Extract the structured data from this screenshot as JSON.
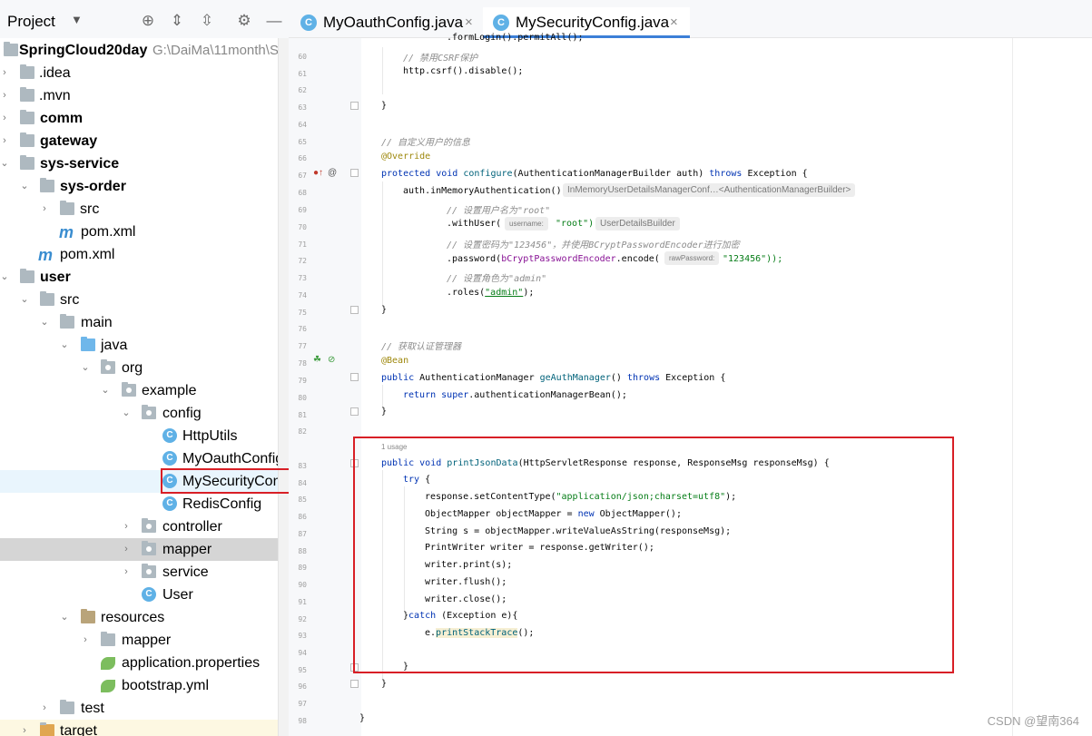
{
  "project_panel": {
    "title": "Project",
    "tree": [
      {
        "label": "SpringCloud20day",
        "path": "G:\\DaiMa\\11month\\S",
        "bold": true
      },
      {
        "label": ".idea"
      },
      {
        "label": ".mvn"
      },
      {
        "label": "comm",
        "bold": true
      },
      {
        "label": "gateway",
        "bold": true
      },
      {
        "label": "sys-service",
        "bold": true
      },
      {
        "label": "sys-order",
        "bold": true
      },
      {
        "label": "src"
      },
      {
        "label": "pom.xml"
      },
      {
        "label": "pom.xml"
      },
      {
        "label": "user",
        "bold": true
      },
      {
        "label": "src"
      },
      {
        "label": "main"
      },
      {
        "label": "java"
      },
      {
        "label": "org"
      },
      {
        "label": "example"
      },
      {
        "label": "config"
      },
      {
        "label": "HttpUtils"
      },
      {
        "label": "MyOauthConfig"
      },
      {
        "label": "MySecurityConfi"
      },
      {
        "label": "RedisConfig"
      },
      {
        "label": "controller"
      },
      {
        "label": "mapper"
      },
      {
        "label": "service"
      },
      {
        "label": "User"
      },
      {
        "label": "resources"
      },
      {
        "label": "mapper"
      },
      {
        "label": "application.properties"
      },
      {
        "label": "bootstrap.yml"
      },
      {
        "label": "test"
      },
      {
        "label": "target"
      }
    ]
  },
  "tabs": [
    {
      "label": "MyOauthConfig.java",
      "close": "×",
      "icon": "C"
    },
    {
      "label": "MySecurityConfig.java",
      "close": "×",
      "icon": "C"
    }
  ],
  "line_numbers": [
    "60",
    "61",
    "62",
    "63",
    "64",
    "65",
    "66",
    "67",
    "68",
    "69",
    "70",
    "71",
    "72",
    "73",
    "74",
    "75",
    "76",
    "77",
    "78",
    "79",
    "80",
    "81",
    "82",
    "83",
    "84",
    "85",
    "86",
    "87",
    "88",
    "89",
    "90",
    "91",
    "92",
    "93",
    "94",
    "95",
    "96",
    "97",
    "98"
  ],
  "code": {
    "top_cut": ".formLogin().permitAll();",
    "c_csrf": "// 禁用CSRF保护",
    "csrf": "http.csrf().disable();",
    "c_user_info": "// 自定义用户的信息",
    "override": "@Override",
    "configure_sig": [
      "protected",
      "void",
      "configure",
      "(AuthenticationManagerBuilder auth)",
      "throws",
      "Exception {"
    ],
    "inmem": "auth.inMemoryAuthentication()",
    "hint_inmem": "InMemoryUserDetailsManagerConf…<AuthenticationManagerBuilder>",
    "c_username": "// 设置用户名为\"root\"",
    "withuser": ".withUser(",
    "hint_username": "username:",
    "root": "\"root\")",
    "hint_udb": "UserDetailsBuilder",
    "c_password": "// 设置密码为\"123456\"，并使用BCryptPasswordEncoder进行加密",
    "password_pre": ".password(",
    "bcrypt": "bCryptPasswordEncoder",
    "encode": ".encode(",
    "hint_raw": "rawPassword:",
    "pwd_val": "\"123456\"));",
    "c_role": "// 设置角色为\"admin\"",
    "roles_pre": ".roles(",
    "admin": "\"admin\"",
    "roles_post": ");",
    "close_brace": "}",
    "c_authmgr": "// 获取认证管理器",
    "bean": "@Bean",
    "getauth_sig": [
      "public",
      "AuthenticationManager",
      "geAuthManager",
      "()",
      "throws",
      "Exception {"
    ],
    "return_line": [
      "return",
      "super",
      ".authenticationManagerBean();"
    ],
    "usage": "1 usage",
    "print_sig": [
      "public",
      "void",
      "printJsonData",
      "(HttpServletResponse response, ResponseMsg responseMsg) {"
    ],
    "try": [
      "try",
      " {"
    ],
    "set_ct": [
      "response.setContentType(",
      "\"application/json;charset=utf8\"",
      ");"
    ],
    "mapper": [
      "ObjectMapper objectMapper = ",
      "new",
      " ObjectMapper();"
    ],
    "string_s": "String s = objectMapper.writeValueAsString(responseMsg);",
    "writer": "PrintWriter writer = response.getWriter();",
    "print": "writer.print(s);",
    "flush": "writer.flush();",
    "close": "writer.close();",
    "catch": [
      "}",
      "catch",
      " (Exception e){"
    ],
    "stacktrace": [
      "e.",
      "printStackTrace",
      "();"
    ]
  },
  "watermark": "CSDN @望南364",
  "colors": {
    "highlight_box": "#d81f26",
    "tab_underline": "#3c7fd7",
    "keyword": "#0033b3",
    "string": "#067d17"
  }
}
